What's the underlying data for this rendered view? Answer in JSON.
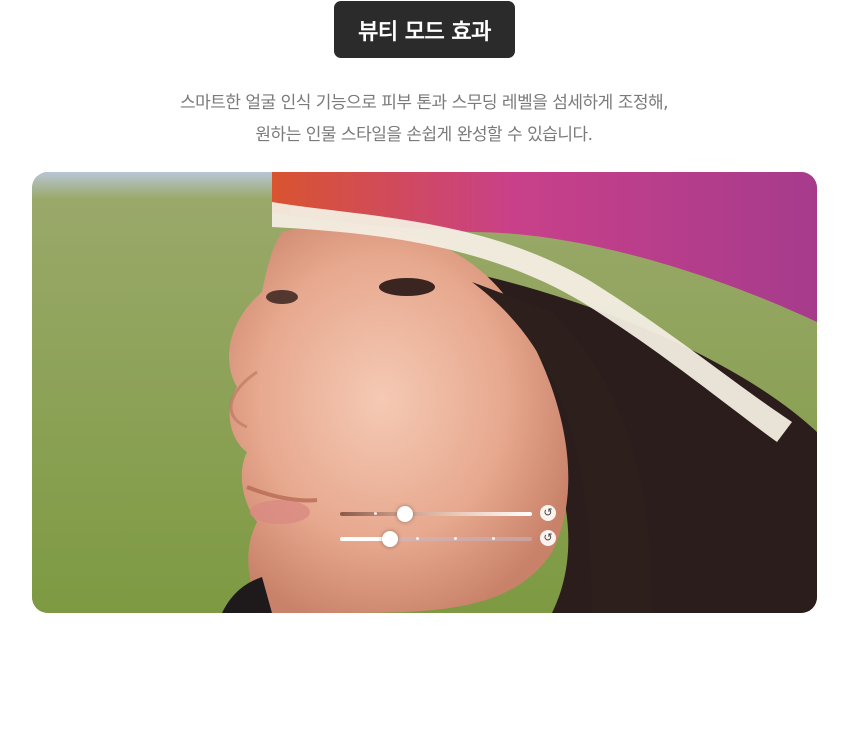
{
  "header": {
    "title": "뷰티 모드 효과"
  },
  "description": {
    "line1": "스마트한 얼굴 인식 기능으로 피부 톤과 스무딩 레벨을 섬세하게 조정해,",
    "line2": "원하는 인물 스타일을 손쉽게 완성할 수 있습니다."
  },
  "beauty_controls": {
    "skin_tone_level": 0.33,
    "smoothing_level": 0.25,
    "reset_icon": "reset-icon"
  },
  "colors": {
    "badge_bg": "#2b2b2b",
    "text_gray": "#7a7a7a",
    "slider_track_1": "#c99a86",
    "slider_track_2": "#d9b3b0"
  }
}
